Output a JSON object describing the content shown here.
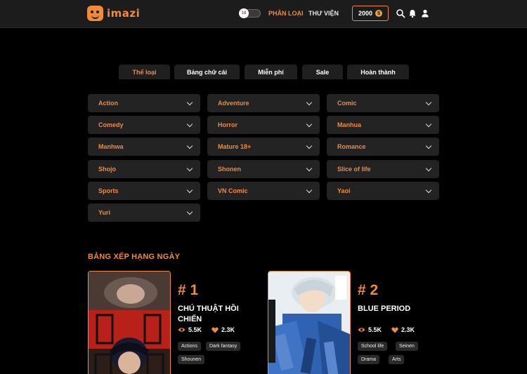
{
  "header": {
    "brand": "imazi",
    "age_badge": "18",
    "nav": {
      "categories": "PHÂN LOẠI",
      "library": "THƯ VIỆN"
    },
    "coins": "2000",
    "accent": "#f08a3c"
  },
  "tabs": [
    "Thể loại",
    "Bảng chữ cái",
    "Miễn phí",
    "Sale",
    "Hoàn thành"
  ],
  "genres": [
    "Action",
    "Adventure",
    "Comic",
    "Comedy",
    "Horror",
    "Manhua",
    "Manhwa",
    "Mature 18+",
    "Romance",
    "Shojo",
    "Shonen",
    "Slice of life",
    "Sports",
    "VN Comic",
    "Yaoi",
    "Yuri"
  ],
  "ranking": {
    "title": "BẢNG XẾP HẠNG NGÀY",
    "items": [
      {
        "rank": "# 1",
        "title": "CHÚ THUẬT HỒI CHIẾN",
        "views": "5.5K",
        "likes": "2.3K",
        "tags": [
          "Actions",
          "Dark fantasy",
          "Shounen"
        ]
      },
      {
        "rank": "# 2",
        "title": "BLUE PERIOD",
        "views": "5.5K",
        "likes": "2.3K",
        "tags": [
          "School life",
          "Seinen",
          "Drama",
          "Arts"
        ]
      }
    ]
  }
}
